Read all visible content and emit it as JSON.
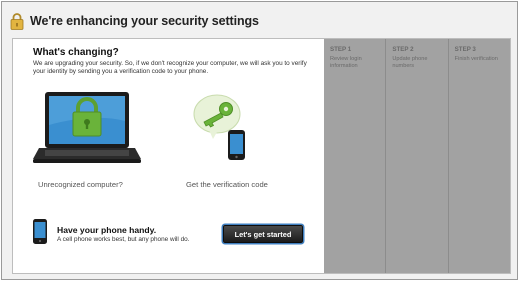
{
  "header": {
    "title": "We're enhancing your security settings",
    "icon": "padlock-icon"
  },
  "main": {
    "heading": "What's changing?",
    "description": "We are upgrading your security. So, if we don't recognize your computer, we will ask you to verify your identity by sending you a verification code to your phone.",
    "illustrations": [
      {
        "icon": "laptop-lock-icon",
        "caption": "Unrecognized computer?"
      },
      {
        "icon": "phone-key-icon",
        "caption": "Get the verification code"
      }
    ],
    "phone_note": {
      "icon": "phone-icon",
      "title": "Have your phone handy.",
      "subtitle": "A cell phone works best, but any phone will do."
    },
    "start_button": "Let's get started"
  },
  "steps": [
    {
      "num": "STEP 1",
      "text": "Review login information"
    },
    {
      "num": "STEP 2",
      "text": "Update phone numbers"
    },
    {
      "num": "STEP 3",
      "text": "Finish verification"
    }
  ],
  "colors": {
    "lock_green": "#6ab33a",
    "button_dark": "#2a2a2a",
    "steps_panel": "#a2a2a2",
    "focus_ring": "#3f7fc0"
  }
}
